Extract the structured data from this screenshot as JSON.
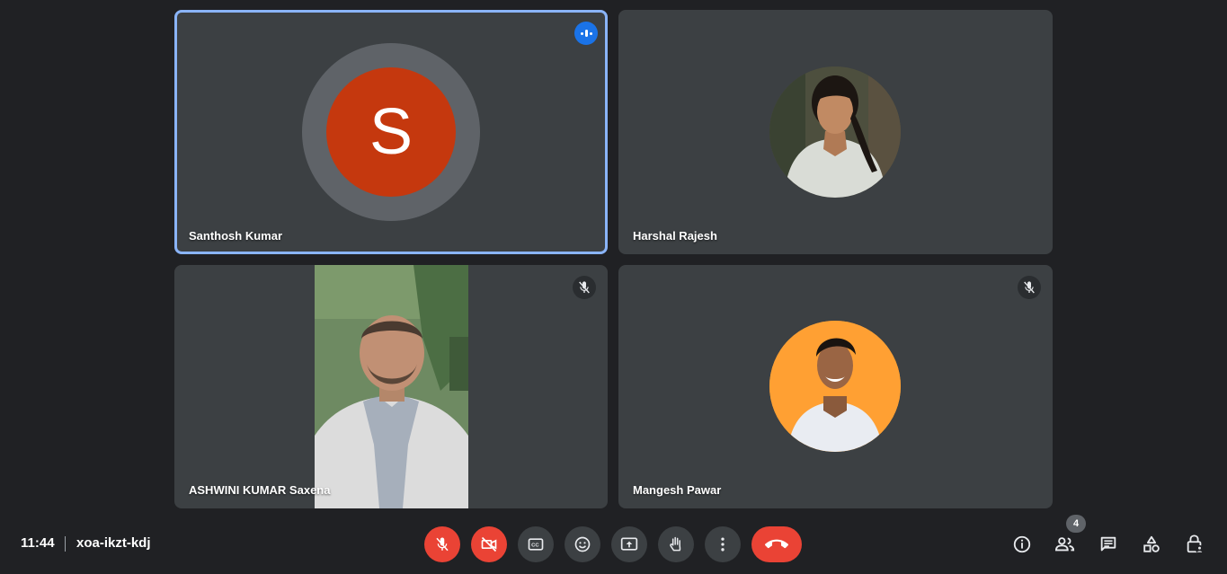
{
  "meeting": {
    "time": "11:44",
    "code": "xoa-ikzt-kdj"
  },
  "participants": [
    {
      "name": "Santhosh Kumar",
      "initial": "S",
      "avatar_color": "#c5380e",
      "state": "speaking"
    },
    {
      "name": "Harshal Rajesh",
      "state": "photo-avatar"
    },
    {
      "name": "ASHWINI KUMAR Saxena",
      "state": "video",
      "muted": true
    },
    {
      "name": "Mangesh Pawar",
      "state": "photo-avatar",
      "muted": true
    }
  ],
  "controls": {
    "mic": "mic-off-icon",
    "camera": "videocam-off-icon",
    "captions": "closed-caption-icon",
    "reactions": "emoji-icon",
    "present": "present-screen-icon",
    "raise_hand": "raise-hand-icon",
    "more": "more-vert-icon",
    "leave": "call-end-icon"
  },
  "side_controls": {
    "participants_count": "4"
  },
  "colors": {
    "accent": "#8ab4f8",
    "danger": "#ea4335",
    "tile": "#3c4043",
    "background": "#202124"
  }
}
